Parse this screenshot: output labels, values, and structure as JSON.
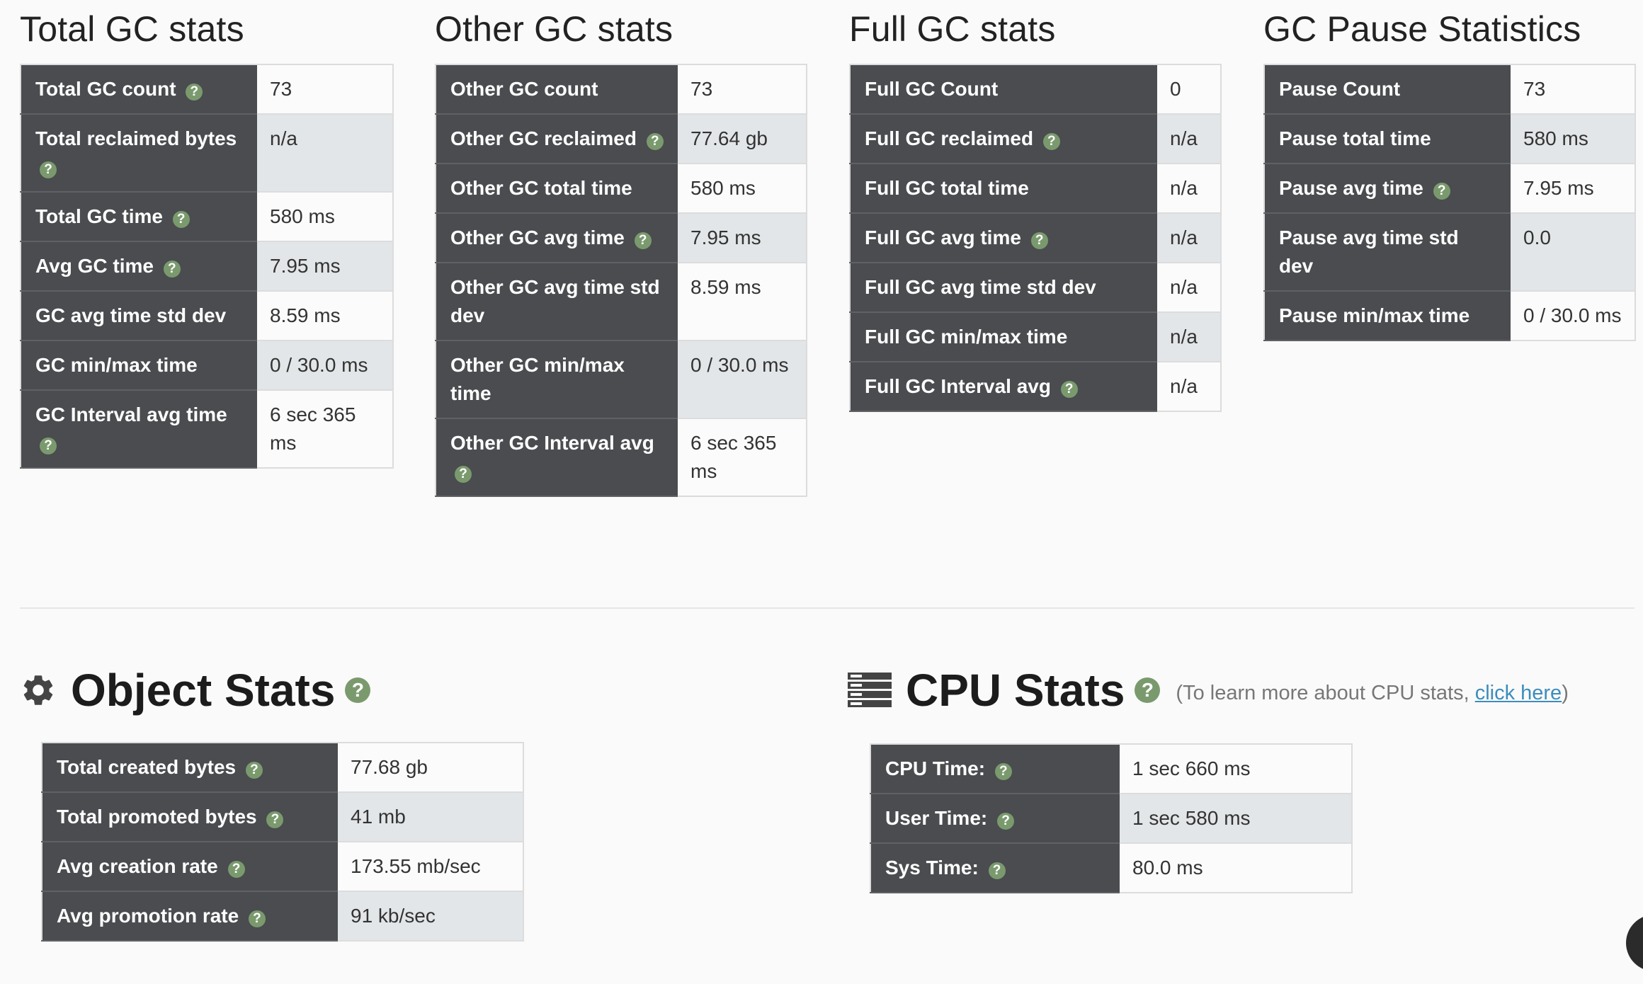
{
  "total_gc": {
    "title": "Total GC stats",
    "rows": [
      {
        "label": "Total GC count",
        "help": true,
        "value": "73"
      },
      {
        "label": "Total reclaimed bytes",
        "help": true,
        "value": "n/a"
      },
      {
        "label": "Total GC time",
        "help": true,
        "value": "580 ms"
      },
      {
        "label": "Avg GC time",
        "help": true,
        "value": "7.95 ms"
      },
      {
        "label": "GC avg time std dev",
        "help": false,
        "value": "8.59 ms"
      },
      {
        "label": "GC min/max time",
        "help": false,
        "value": "0 / 30.0 ms"
      },
      {
        "label": "GC Interval avg time",
        "help": true,
        "value": "6 sec 365 ms"
      }
    ]
  },
  "other_gc": {
    "title": "Other GC stats",
    "rows": [
      {
        "label": "Other GC count",
        "help": false,
        "value": "73"
      },
      {
        "label": "Other GC reclaimed",
        "help": true,
        "value": "77.64 gb"
      },
      {
        "label": "Other GC total time",
        "help": false,
        "value": "580 ms"
      },
      {
        "label": "Other GC avg time",
        "help": true,
        "value": "7.95 ms"
      },
      {
        "label": "Other GC avg time std dev",
        "help": false,
        "value": "8.59 ms"
      },
      {
        "label": "Other GC min/max time",
        "help": false,
        "value": "0 / 30.0 ms"
      },
      {
        "label": "Other GC Interval avg",
        "help": true,
        "value": "6 sec 365 ms"
      }
    ]
  },
  "full_gc": {
    "title": "Full GC stats",
    "rows": [
      {
        "label": "Full GC Count",
        "help": false,
        "value": "0"
      },
      {
        "label": "Full GC reclaimed",
        "help": true,
        "value": "n/a"
      },
      {
        "label": "Full GC total time",
        "help": false,
        "value": "n/a"
      },
      {
        "label": "Full GC avg time",
        "help": true,
        "value": "n/a"
      },
      {
        "label": "Full GC avg time std dev",
        "help": false,
        "value": "n/a"
      },
      {
        "label": "Full GC min/max time",
        "help": false,
        "value": "n/a"
      },
      {
        "label": "Full GC Interval avg",
        "help": true,
        "value": "n/a"
      }
    ]
  },
  "pause": {
    "title": "GC Pause Statistics",
    "rows": [
      {
        "label": "Pause Count",
        "help": false,
        "value": "73"
      },
      {
        "label": "Pause total time",
        "help": false,
        "value": "580 ms"
      },
      {
        "label": "Pause avg time",
        "help": true,
        "value": "7.95 ms"
      },
      {
        "label": "Pause avg time std dev",
        "help": false,
        "value": "0.0"
      },
      {
        "label": "Pause min/max time",
        "help": false,
        "value": "0 / 30.0 ms"
      }
    ]
  },
  "object_stats": {
    "title": "Object Stats",
    "icon": "gear-icon",
    "rows": [
      {
        "label": "Total created bytes",
        "help": true,
        "value": "77.68 gb"
      },
      {
        "label": "Total promoted bytes",
        "help": true,
        "value": "41 mb"
      },
      {
        "label": "Avg creation rate",
        "help": true,
        "value": "173.55 mb/sec"
      },
      {
        "label": "Avg promotion rate",
        "help": true,
        "value": "91 kb/sec"
      }
    ]
  },
  "cpu_stats": {
    "title": "CPU Stats",
    "icon": "server-icon",
    "note_prefix": "(To learn more about CPU stats, ",
    "note_link": "click here",
    "note_suffix": ")",
    "rows": [
      {
        "label": "CPU Time:",
        "help": true,
        "value": "1 sec 660 ms"
      },
      {
        "label": "User Time:",
        "help": true,
        "value": "1 sec 580 ms"
      },
      {
        "label": "Sys Time:",
        "help": true,
        "value": "80.0 ms"
      }
    ]
  },
  "help_glyph": "?",
  "colors": {
    "header_cell": "#4a4c4f",
    "help_badge": "#7a9a6e",
    "link": "#3c8dbc"
  }
}
